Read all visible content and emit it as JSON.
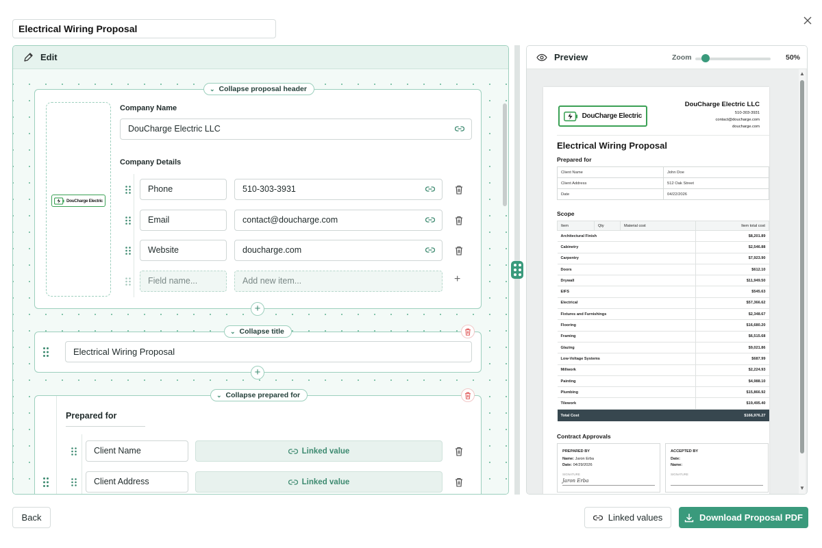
{
  "document_title": "Electrical Wiring Proposal",
  "edit_panel": {
    "heading": "Edit",
    "header_section": {
      "collapse_label": "Collapse proposal header",
      "company_name_label": "Company Name",
      "company_name_value": "DouCharge Electric LLC",
      "company_details_label": "Company Details",
      "logo_text": "DouCharge Electric",
      "details": [
        {
          "name": "Phone",
          "value": "510-303-3931"
        },
        {
          "name": "Email",
          "value": "contact@doucharge.com"
        },
        {
          "name": "Website",
          "value": "doucharge.com"
        }
      ],
      "new_field_placeholder": "Field name...",
      "new_item_placeholder": "Add new item..."
    },
    "title_section": {
      "collapse_label": "Collapse title",
      "title_value": "Electrical Wiring Proposal"
    },
    "prepared_section": {
      "collapse_label": "Collapse prepared for",
      "heading": "Prepared for",
      "rows": [
        {
          "name": "Client Name",
          "value": "Linked value"
        },
        {
          "name": "Client Address",
          "value": "Linked value"
        }
      ]
    }
  },
  "preview_panel": {
    "heading": "Preview",
    "zoom_label": "Zoom",
    "zoom_value": "50%",
    "zoom_level": 0.1,
    "sheet": {
      "company_name": "DouCharge Electric LLC",
      "company_lines": [
        "510-303-3931",
        "contact@doucharge.com",
        "doucharge.com"
      ],
      "logo_text": "DouCharge Electric",
      "title": "Electrical Wiring Proposal",
      "prepared_heading": "Prepared for",
      "prepared_rows": [
        {
          "k": "Client Name",
          "v": "John Doe"
        },
        {
          "k": "Client Address",
          "v": "512 Oak Street"
        },
        {
          "k": "Date",
          "v": "04/22/2026"
        }
      ],
      "scope_heading": "Scope",
      "scope_headers": {
        "item": "Item",
        "qty": "Qty",
        "material": "Material cost",
        "total": "Item total cost"
      },
      "scope_rows": [
        {
          "item": "Architectural Finish",
          "total": "$8,201.89"
        },
        {
          "item": "Cabinetry",
          "total": "$2,546.88"
        },
        {
          "item": "Carpentry",
          "total": "$7,923.90"
        },
        {
          "item": "Doors",
          "total": "$612.10"
        },
        {
          "item": "Drywall",
          "total": "$11,949.50"
        },
        {
          "item": "EIFS",
          "total": "$545.63"
        },
        {
          "item": "Electrical",
          "total": "$57,366.62"
        },
        {
          "item": "Fixtures and Furnishings",
          "total": "$2,348.67"
        },
        {
          "item": "Flooring",
          "total": "$16,680.20"
        },
        {
          "item": "Framing",
          "total": "$6,515.68"
        },
        {
          "item": "Glazing",
          "total": "$9,021.86"
        },
        {
          "item": "Low-Voltage Systems",
          "total": "$687.99"
        },
        {
          "item": "Millwork",
          "total": "$2,224.93"
        },
        {
          "item": "Painting",
          "total": "$4,988.10"
        },
        {
          "item": "Plumbing",
          "total": "$15,866.92"
        },
        {
          "item": "Tilework",
          "total": "$19,495.40"
        }
      ],
      "total_label": "Total Cost",
      "total_value": "$166,976.27",
      "approvals_heading": "Contract Approvals",
      "prepared_by": {
        "heading": "PREPARED BY",
        "name_label": "Name:",
        "name": "Jaron Erba",
        "date_label": "Date:",
        "date": "04/29/2026",
        "signature_label": "SIGNATURE",
        "signature": "Jaron Erba"
      },
      "accepted_by": {
        "heading": "ACCEPTED BY",
        "date_label": "Date:",
        "name_label": "Name:",
        "signature_label": "SIGNATURE"
      }
    }
  },
  "footer": {
    "back_label": "Back",
    "linked_values_label": "Linked values",
    "download_label": "Download Proposal PDF"
  },
  "colors": {
    "accent": "#3a9a7c",
    "danger": "#e05a5a",
    "total_row": "#37474f"
  }
}
